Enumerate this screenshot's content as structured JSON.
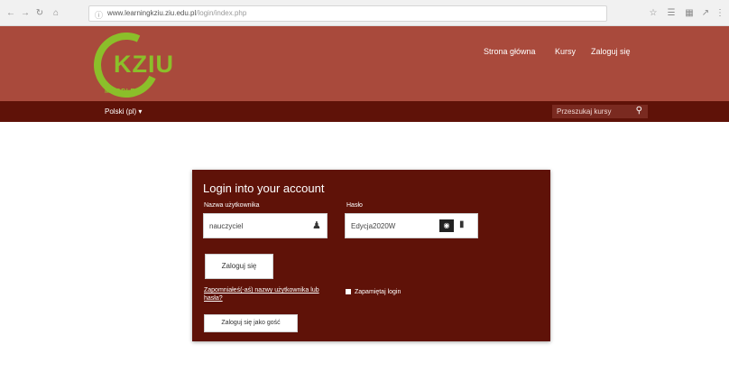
{
  "browser": {
    "url_host": "www.learningkziu.ziu.edu.pl",
    "url_path": "/login/index.php"
  },
  "site": {
    "logo_text": "KZIU",
    "logo_sub": "MOODLE",
    "nav": {
      "home": "Strona główna",
      "courses": "Kursy",
      "login": "Zaloguj się"
    },
    "language": "Polski (pl) ▾",
    "search_placeholder": "Przeszukaj kursy"
  },
  "login": {
    "title": "Login into your account",
    "username_label": "Nazwa użytkownika",
    "username_value": "nauczyciel",
    "password_label": "Hasło",
    "password_value": "Edycja2020W",
    "login_button": "Zaloguj się",
    "forgot_link": "Zapomniałeś(-aś) nazwy użytkownika lub hasła?",
    "remember_label": "Zapamiętaj login",
    "guest_button": "Zaloguj się jako gość"
  }
}
